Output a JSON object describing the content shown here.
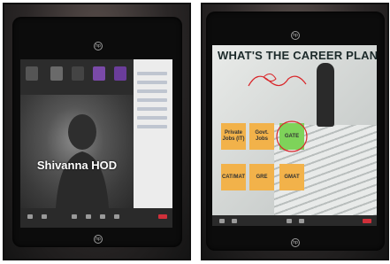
{
  "left_photo": {
    "presenter_name": "Shivanna HOD"
  },
  "right_photo": {
    "slide_title": "WHAT'S THE CAREER PLAN?",
    "options": [
      {
        "label": "Private Jobs (IT)",
        "highlight": false
      },
      {
        "label": "Govt. Jobs",
        "highlight": false
      },
      {
        "label": "GATE",
        "highlight": true
      },
      {
        "label": "CAT/MAT",
        "highlight": false
      },
      {
        "label": "GRE",
        "highlight": false
      },
      {
        "label": "GMAT",
        "highlight": false
      }
    ]
  },
  "colors": {
    "option_box": "#f2b24a",
    "highlight_box": "#7ed35a",
    "annotation_ink": "#d9262a"
  }
}
